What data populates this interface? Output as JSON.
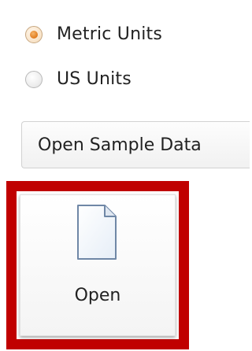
{
  "units": {
    "options": [
      {
        "label": "Metric Units",
        "selected": true
      },
      {
        "label": "US Units",
        "selected": false
      }
    ]
  },
  "sample_data_button": {
    "label": "Open Sample Data"
  },
  "open_button": {
    "label": "Open",
    "icon": "document-icon"
  },
  "colors": {
    "highlight": "#c00000",
    "radio_selected": "#e07b1d"
  }
}
